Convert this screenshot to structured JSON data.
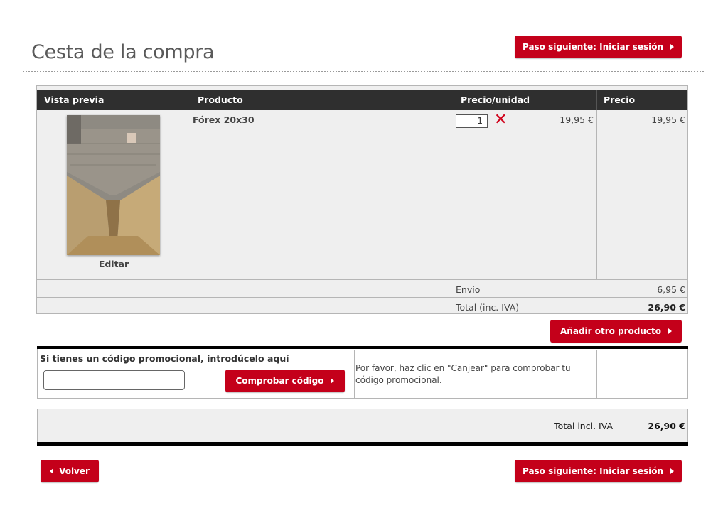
{
  "page": {
    "title": "Cesta de la compra",
    "next_step_label": "Paso siguiente: Iniciar sesión",
    "back_label": "Volver"
  },
  "cart": {
    "headers": [
      "Vista previa",
      "Producto",
      "Precio/unidad",
      "Precio"
    ],
    "item": {
      "edit_label": "Editar",
      "product_name": "Fórex 20x30",
      "quantity": "1",
      "unit_price": "19,95 €",
      "price": "19,95 €"
    },
    "shipping_label": "Envío",
    "shipping_value": "6,95 €",
    "total_label": "Total (inc. IVA)",
    "total_value": "26,90 €",
    "add_product_label": "Añadir otro producto"
  },
  "promo": {
    "prompt": "Si tienes un código promocional, introdúcelo aquí",
    "input_value": "",
    "check_label": "Comprobar código",
    "info": "Por favor, haz clic en \"Canjear\" para comprobar tu código promocional."
  },
  "summary": {
    "label": "Total incl. IVA",
    "value": "26,90 €"
  },
  "colors": {
    "accent": "#c4001a",
    "header_bg": "#2f2f2f",
    "remove": "#d0021b"
  },
  "icons": {
    "remove": "x-mark-icon",
    "next": "triangle-right-icon",
    "back": "triangle-left-icon"
  }
}
